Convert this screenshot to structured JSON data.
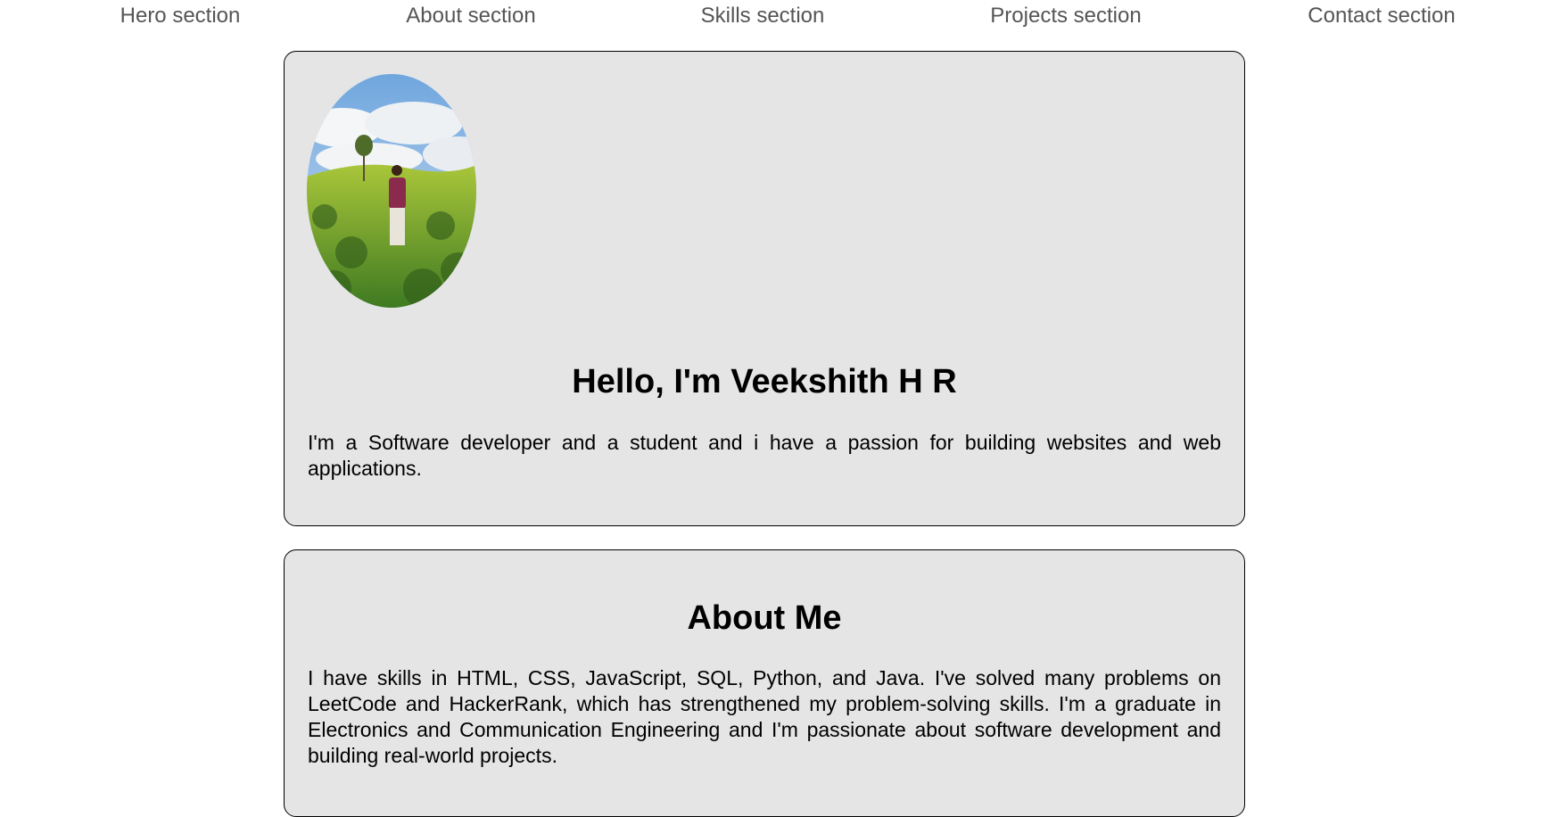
{
  "nav": {
    "items": [
      {
        "label": "Hero section"
      },
      {
        "label": "About section"
      },
      {
        "label": "Skills section"
      },
      {
        "label": "Projects section"
      },
      {
        "label": "Contact section"
      }
    ]
  },
  "hero": {
    "photo_icon": "profile-photo",
    "title": "Hello, I'm Veekshith H R",
    "description": "I'm a Software developer and a student and i have a passion for building websites and web applications."
  },
  "about": {
    "title": "About Me",
    "description": "I have skills in HTML, CSS, JavaScript, SQL, Python, and Java. I've solved many problems on LeetCode and HackerRank, which has strengthened my problem-solving skills. I'm a graduate in Electronics and Communication Engineering and I'm passionate about software development and building real-world projects."
  },
  "colors": {
    "card_background": "#e5e5e5",
    "nav_text": "#555555",
    "border": "#000000"
  }
}
